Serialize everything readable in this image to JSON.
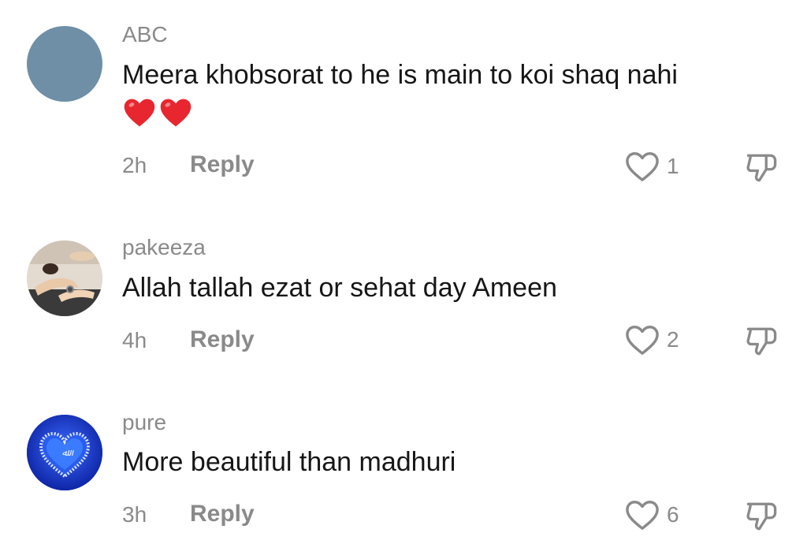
{
  "comments": [
    {
      "username": "ABC",
      "text": "Meera khobsorat to he is main to koi shaq nahi",
      "emoji": "❤️❤️",
      "time": "2h",
      "reply_label": "Reply",
      "like_count": "1",
      "avatar_color": "#6e8fa6"
    },
    {
      "username": "pakeeza",
      "text": "Allah tallah ezat or sehat day Ameen",
      "time": "4h",
      "reply_label": "Reply",
      "like_count": "2",
      "avatar_icon": "hands-photo"
    },
    {
      "username": "pure",
      "text": "More beautiful than madhuri",
      "time": "3h",
      "reply_label": "Reply",
      "like_count": "6",
      "avatar_icon": "blue-heart-photo",
      "avatar_color": "#1a3fd6"
    }
  ],
  "colors": {
    "text": "#161616",
    "muted": "#8a8a8a",
    "heart_red": "#e8262f"
  }
}
